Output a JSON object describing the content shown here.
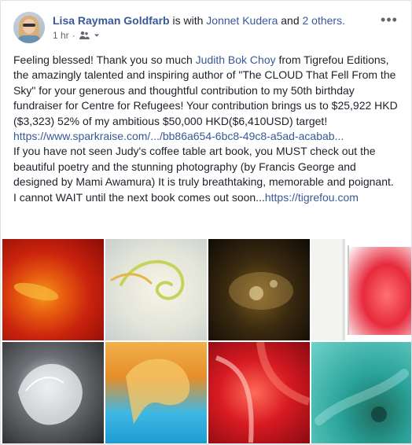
{
  "post": {
    "author": "Lisa Rayman Goldfarb",
    "with_text": "is with",
    "tagged": "Jonnet Kudera",
    "and_text": "and",
    "others": "2 others.",
    "time": "1 hr",
    "separator": "·",
    "more": "•••",
    "body": {
      "p1_text_a": "Feeling blessed! Thank you so much ",
      "p1_link_a": "Judith Bok Choy",
      "p1_text_b": " from Tigrefou Editions, the amazingly talented and inspiring author of \"The CLOUD That Fell From the Sky\" for your generous and thoughtful contribution to my 50th birthday fundraiser for Centre for Refugees! Your contribution brings us to $25,922 HKD ($3,323) 52% of my ambitious $50,000 HKD($6,410USD) target! ",
      "p1_link_b": "https://www.sparkraise.com/.../bb86a654-6bc8-49c8-a5ad-acabab...",
      "p2_text_a": "If you have not seen Judy's coffee table art book, you MUST check out the beautiful poetry and the stunning photography (by Francis George and designed by Mami Awamura) It is truly breathtaking, memorable and poignant. I cannot WAIT until the next book comes out soon...",
      "p2_link_a": "https://tigrefou.com"
    }
  },
  "icons": {
    "audience": "friends-icon",
    "dropdown": "caret-down-icon"
  },
  "colors": {
    "link": "#385898",
    "text": "#1d2129",
    "meta": "#616770"
  }
}
